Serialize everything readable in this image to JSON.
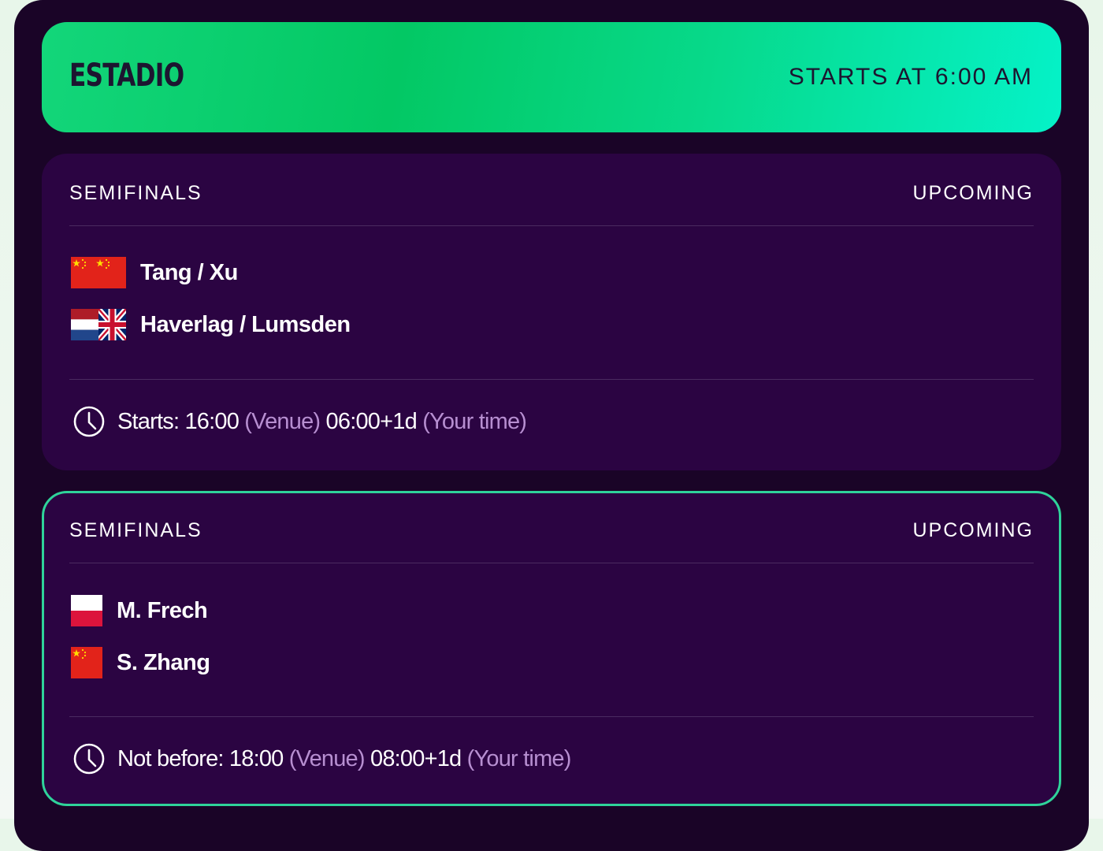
{
  "header": {
    "venue": "ESTADIO",
    "starts_at": "STARTS AT 6:00 AM"
  },
  "matches": [
    {
      "round": "SEMIFINALS",
      "status": "UPCOMING",
      "players": [
        {
          "name": "Tang / Xu",
          "flags": [
            "china-flag"
          ]
        },
        {
          "name": "Haverlag / Lumsden",
          "flags": [
            "netherlands-flag",
            "uk-flag"
          ]
        }
      ],
      "time": {
        "label": "Starts: 16:00",
        "venue_tag": "(Venue)",
        "local": "06:00+1d",
        "local_tag": "(Your time)"
      },
      "highlighted": false
    },
    {
      "round": "SEMIFINALS",
      "status": "UPCOMING",
      "players": [
        {
          "name": "M. Frech",
          "flags": [
            "poland-flag"
          ]
        },
        {
          "name": "S. Zhang",
          "flags": [
            "china-flag"
          ]
        }
      ],
      "time": {
        "label": "Not before: 18:00",
        "venue_tag": "(Venue)",
        "local": "08:00+1d",
        "local_tag": "(Your time)"
      },
      "highlighted": true
    }
  ],
  "colors": {
    "frame": "#1a0427",
    "card": "#2b0442",
    "accent_green": "#03c864",
    "accent_teal": "#05f2c8",
    "highlight_border": "#2fd39a",
    "muted_text": "#b78fd1"
  }
}
